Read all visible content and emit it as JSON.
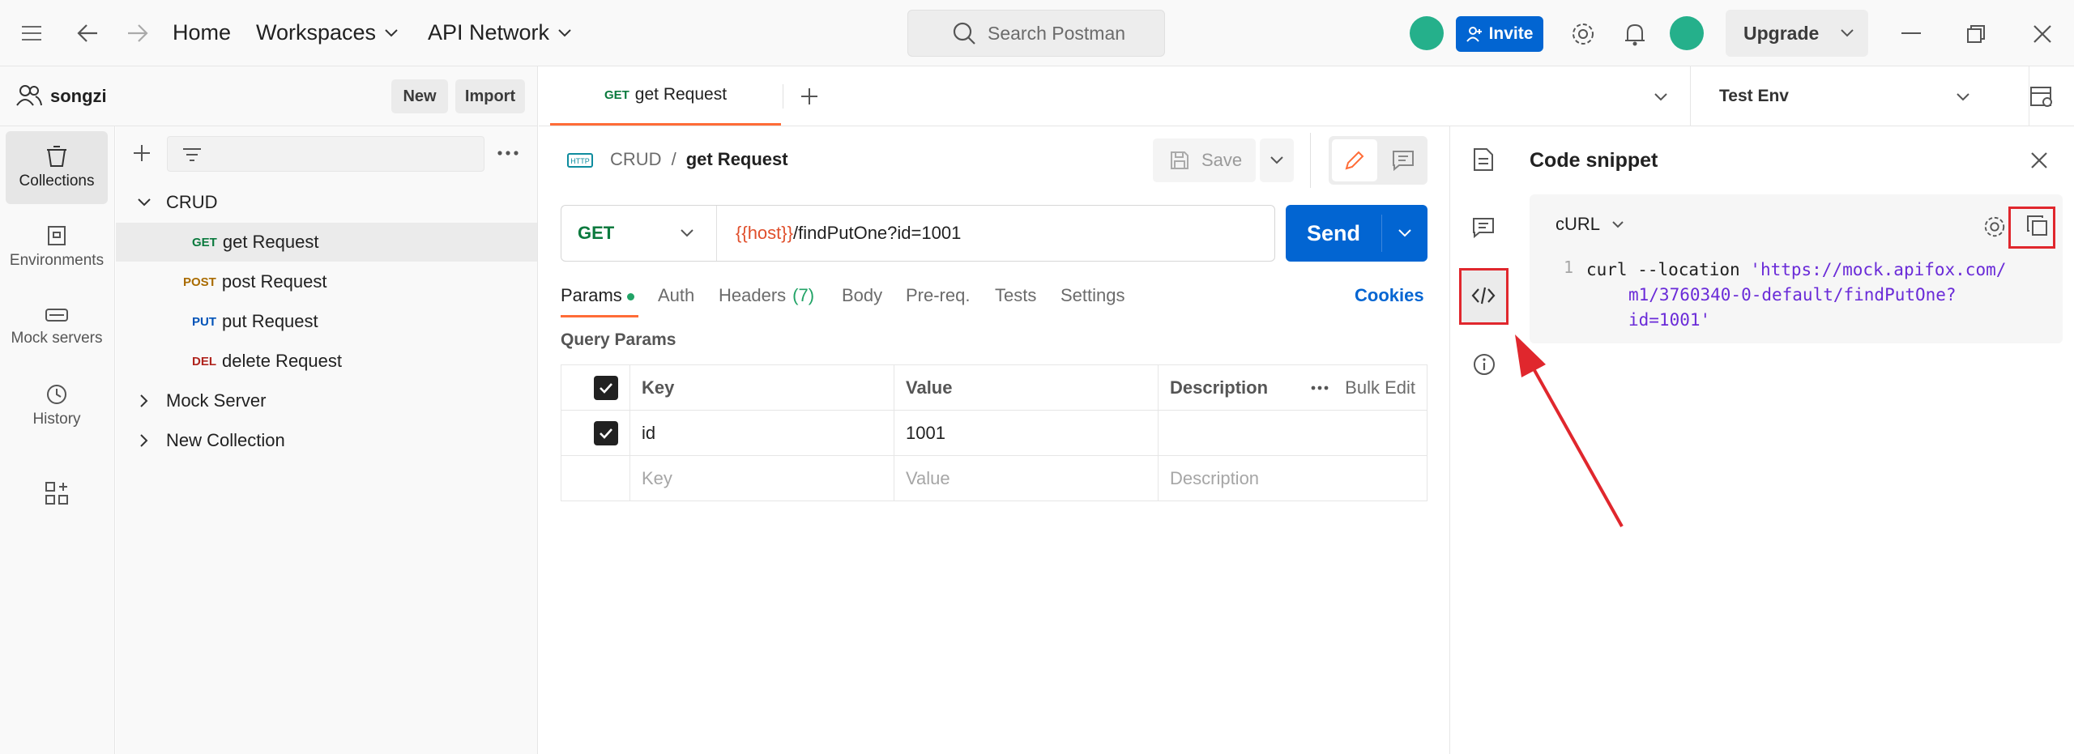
{
  "topbar": {
    "home": "Home",
    "workspaces": "Workspaces",
    "api_network": "API Network",
    "search_placeholder": "Search Postman",
    "invite": "Invite",
    "upgrade": "Upgrade"
  },
  "workspace": {
    "name": "songzi",
    "new_label": "New",
    "import_label": "Import"
  },
  "rail": [
    {
      "label": "Collections",
      "icon": "collections-icon",
      "active": true
    },
    {
      "label": "Environments",
      "icon": "environments-icon"
    },
    {
      "label": "Mock servers",
      "icon": "mock-servers-icon"
    },
    {
      "label": "History",
      "icon": "history-icon"
    }
  ],
  "tree": {
    "crud": "CRUD",
    "requests": [
      {
        "method": "GET",
        "name": "get Request"
      },
      {
        "method": "POST",
        "name": "post Request"
      },
      {
        "method": "PUT",
        "name": "put Request"
      },
      {
        "method": "DEL",
        "name": "delete Request"
      }
    ],
    "mock_server": "Mock Server",
    "new_collection": "New Collection"
  },
  "tab": {
    "method": "GET",
    "name": "get Request"
  },
  "env": {
    "name": "Test Env"
  },
  "request": {
    "breadcrumb_parent": "CRUD",
    "breadcrumb_sep": "/",
    "title": "get Request",
    "save": "Save",
    "method": "GET",
    "url_var": "{{host}}",
    "url_path": "/findPutOne?id=1001",
    "send": "Send",
    "tabs": {
      "params": "Params",
      "auth": "Auth",
      "headers": "Headers",
      "headers_count": "(7)",
      "body": "Body",
      "prereq": "Pre-req.",
      "tests": "Tests",
      "settings": "Settings",
      "cookies": "Cookies"
    },
    "query_params_title": "Query Params",
    "table": {
      "key": "Key",
      "value": "Value",
      "description": "Description",
      "bulk_edit": "Bulk Edit",
      "row_key": "id",
      "row_value": "1001",
      "ph_key": "Key",
      "ph_value": "Value",
      "ph_description": "Description"
    }
  },
  "snippet": {
    "title": "Code snippet",
    "language": "cURL",
    "line_no": "1",
    "cmd": "curl --location ",
    "url_line1": "'https://mock.apifox.com/",
    "url_line2": "m1/3760340-0-default/findPutOne?",
    "url_line3": "id=1001'"
  },
  "colors": {
    "accent_blue": "#0265d2",
    "orange": "#ff6c37",
    "highlight_red": "#e0272d"
  }
}
